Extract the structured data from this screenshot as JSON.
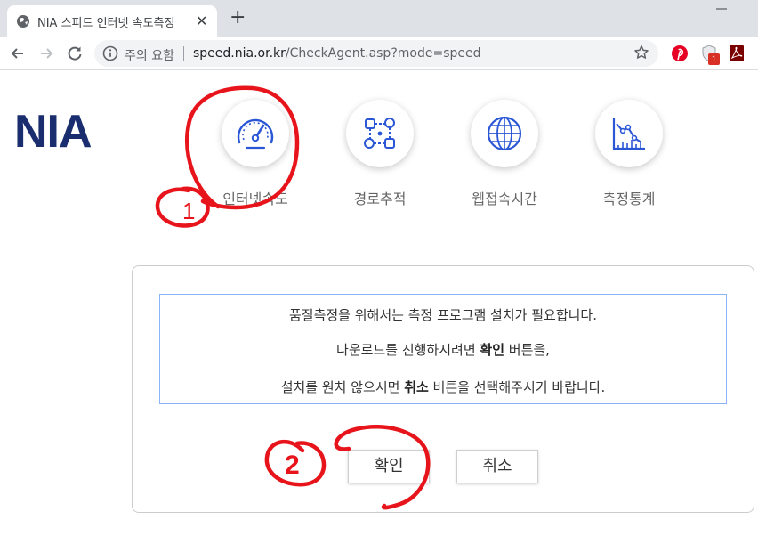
{
  "browser": {
    "tab_title": "NIA 스피드 인터넷 속도측정",
    "tab_close": "✕",
    "new_tab": "+",
    "security_label": "주의 요함",
    "url_host": "speed.nia.or.kr",
    "url_path": "/CheckAgent.asp?mode=speed",
    "extension_badge": "1"
  },
  "page": {
    "logo": "NIA",
    "menu": [
      {
        "label": "인터넷속도",
        "icon": "speedometer-icon"
      },
      {
        "label": "경로추적",
        "icon": "route-trace-icon"
      },
      {
        "label": "웹접속시간",
        "icon": "globe-icon"
      },
      {
        "label": "측정통계",
        "icon": "statistics-icon"
      }
    ],
    "message": {
      "line1": "품질측정을 위해서는 측정 프로그램 설치가 필요합니다.",
      "line2_pre": "다운로드를 진행하시려면 ",
      "line2_bold": "확인",
      "line2_post": " 버튼을,",
      "line3_pre": "설치를 원치 않으시면 ",
      "line3_bold": "취소",
      "line3_post": " 버튼을 선택해주시기 바랍니다."
    },
    "confirm_button": "확인",
    "cancel_button": "취소"
  },
  "annotations": {
    "mark1": "1",
    "mark2": "2",
    "color": "#e8141b"
  }
}
